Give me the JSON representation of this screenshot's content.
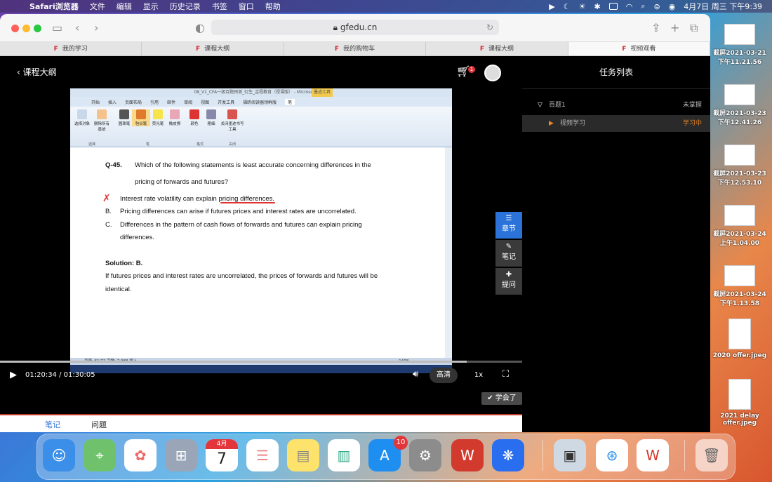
{
  "menubar": {
    "app": "Safari浏览器",
    "items": [
      "文件",
      "编辑",
      "显示",
      "历史记录",
      "书签",
      "窗口",
      "帮助"
    ],
    "clock": "4月7日 周三 下午9:39"
  },
  "browser": {
    "url": "gfedu.cn",
    "tabs": [
      "我的学习",
      "课程大纲",
      "我的购物车",
      "课程大纲",
      "视频观看"
    ]
  },
  "player": {
    "back_label": "课程大纲",
    "cart_count": "1",
    "current_time": "01:20:34 / 01:30:05",
    "quality": "高清",
    "speed": "1x",
    "progress": 0.894,
    "learned_label": "学会了",
    "side_buttons": [
      "章节",
      "笔记",
      "提问"
    ]
  },
  "below_tabs": [
    "笔记",
    "问题"
  ],
  "word": {
    "title": "08_V1_CFA一级百题预测_衍生_金程教育（授课版） - Microsoft Word",
    "context_tab": "墨迹工具",
    "tabs": [
      "开始",
      "插入",
      "页面布局",
      "引用",
      "邮件",
      "审阅",
      "视图",
      "开发工具",
      "福昕阅读器领鲜版",
      "笔"
    ],
    "ribbon_buttons": [
      "选择对象",
      "删除所有墨迹",
      "圆珠笔",
      "毡尖笔",
      "荧光笔",
      "橡皮擦",
      "颜色",
      "粗细",
      "关闭墨迹书写工具"
    ],
    "ribbon_groups": [
      "选择",
      "笔",
      "格式",
      "关闭"
    ],
    "status": "页面: 61/72   字数: 7,988   插入",
    "zoom": "140%"
  },
  "document": {
    "q_number": "Q-45.",
    "question_line1": "Which of the following statements is least accurate concerning differences in the",
    "question_line2": "pricing of forwards and futures?",
    "option_a": "Interest rate volatility can explain pricing differences.",
    "option_b_label": "B.",
    "option_b": "Pricing differences can arise if futures prices and interest rates are uncorrelated.",
    "option_c_label": "C.",
    "option_c_line1": "Differences in the pattern of cash flows of forwards and futures can explain pricing",
    "option_c_line2": "differences.",
    "solution": "Solution: B.",
    "explanation_line1": "If futures prices and interest rates are uncorrelated, the prices of forwards and futures will be",
    "explanation_line2": "identical."
  },
  "tasks": {
    "title": "任务列表",
    "section_name": "百题1",
    "section_status": "未掌握",
    "item_name": "视频学习",
    "item_status": "学习中"
  },
  "desktop_files": [
    "截屏2021-03-21 下午11.21.56",
    "截屏2021-03-23 下午12.41.26",
    "截屏2021-03-23 下午12.53.10",
    "截屏2021-03-24 上午1.04.00",
    "截屏2021-03-24 下午1.13.58",
    "2020 offer.jpeg",
    "2021 delay offer.jpeg"
  ],
  "dock": {
    "calendar_month": "4月",
    "calendar_day": "7",
    "appstore_badge": "10"
  },
  "colors": {
    "accent_blue": "#2b73d8",
    "status_orange": "#e8872a",
    "cart_red": "#e2363b"
  }
}
